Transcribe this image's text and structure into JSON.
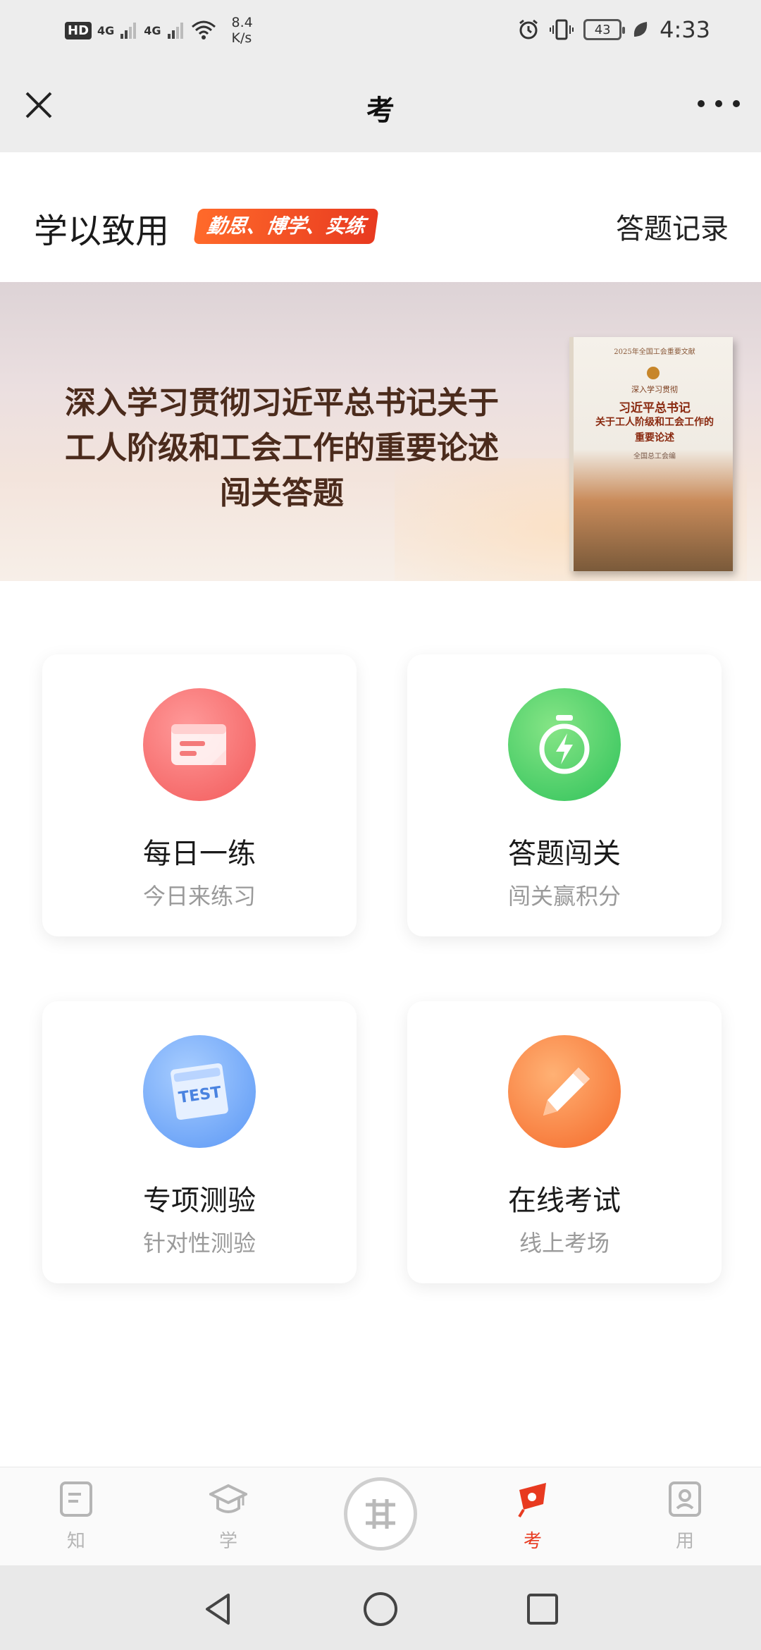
{
  "status_bar": {
    "hd": "HD",
    "sim1": "4G",
    "sim2": "4G",
    "speed_value": "8.4",
    "speed_unit": "K/s",
    "battery": "43",
    "time": "4:33"
  },
  "title_bar": {
    "title": "考"
  },
  "header": {
    "title": "学以致用",
    "tag": "勤思、博学、实练",
    "record_link": "答题记录"
  },
  "banner": {
    "lines": [
      "深入学习贯彻习近平总书记关于",
      "工人阶级和工会工作的重要论述",
      "闯关答题"
    ],
    "book": {
      "top_text": "2025年全国工会重要文献",
      "series": "深入学习贯彻",
      "title_line1": "习近平总书记",
      "title_line2": "关于工人阶级和工会工作的",
      "title_line3": "重要论述",
      "publisher": "全国总工会编"
    }
  },
  "cards": [
    {
      "title": "每日一练",
      "subtitle": "今日来练习",
      "icon": "calendar-card-icon",
      "color": "#f25a5a"
    },
    {
      "title": "答题闯关",
      "subtitle": "闯关赢积分",
      "icon": "stopwatch-bolt-icon",
      "color": "#2fc25a"
    },
    {
      "title": "专项测验",
      "subtitle": "针对性测验",
      "icon": "test-paper-icon",
      "color": "#5a97f5",
      "icon_text": "TEST"
    },
    {
      "title": "在线考试",
      "subtitle": "线上考场",
      "icon": "pencil-icon",
      "color": "#f56a2a"
    }
  ],
  "bottom_nav": {
    "items": [
      {
        "label": "知",
        "icon": "document-icon"
      },
      {
        "label": "学",
        "icon": "graduation-cap-icon"
      },
      {
        "label": "",
        "icon": "center-logo-icon"
      },
      {
        "label": "考",
        "icon": "exam-flag-icon",
        "active": true
      },
      {
        "label": "用",
        "icon": "profile-card-icon"
      }
    ]
  },
  "colors": {
    "accent": "#e83a20",
    "bar_bg": "#ededed"
  }
}
